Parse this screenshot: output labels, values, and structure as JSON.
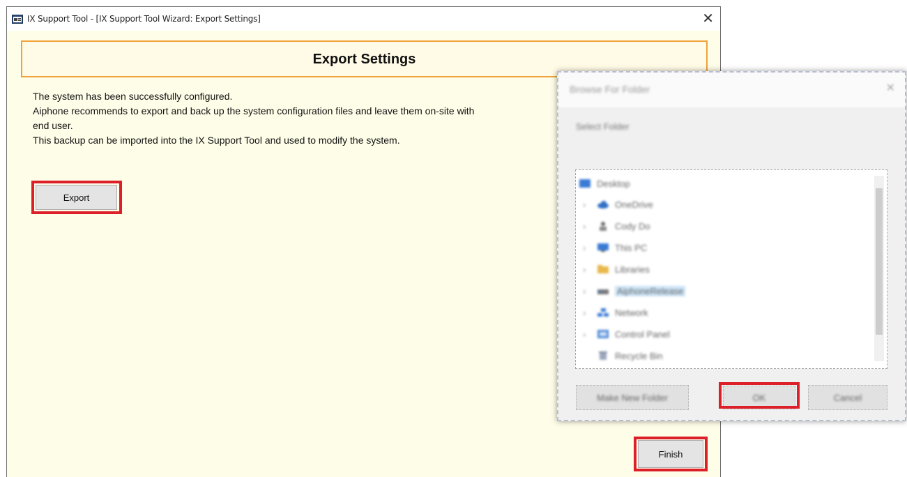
{
  "window": {
    "title": "IX Support Tool - [IX Support Tool Wizard: Export Settings]",
    "close_glyph": "✕",
    "icon": "app-window-icon"
  },
  "header": {
    "title": "Export Settings"
  },
  "description": {
    "line1": "The system has been successfully configured.",
    "line2": "Aiphone recommends to export and back up the system configuration files and leave them on-site with",
    "line3": "end user.",
    "line4": "This backup can be imported into the IX Support Tool and used to modify the system."
  },
  "buttons": {
    "export": "Export",
    "finish": "Finish"
  },
  "highlight_color": "#dd1f2a",
  "dialog": {
    "title": "Browse For Folder",
    "close_glyph": "✕",
    "label": "Select Folder",
    "tree": [
      {
        "label": "Desktop",
        "icon": "desktop-icon"
      },
      {
        "label": "OneDrive",
        "icon": "cloud-icon"
      },
      {
        "label": "Cody Do",
        "icon": "user-icon"
      },
      {
        "label": "This PC",
        "icon": "computer-icon"
      },
      {
        "label": "Libraries",
        "icon": "folder-icon"
      },
      {
        "label": "AiphoneRelease",
        "icon": "drive-icon",
        "selected": true
      },
      {
        "label": "Network",
        "icon": "network-icon"
      },
      {
        "label": "Control Panel",
        "icon": "control-panel-icon"
      },
      {
        "label": "Recycle Bin",
        "icon": "recycle-bin-icon"
      }
    ],
    "buttons": {
      "new_folder": "Make New Folder",
      "ok": "OK",
      "cancel": "Cancel"
    }
  }
}
